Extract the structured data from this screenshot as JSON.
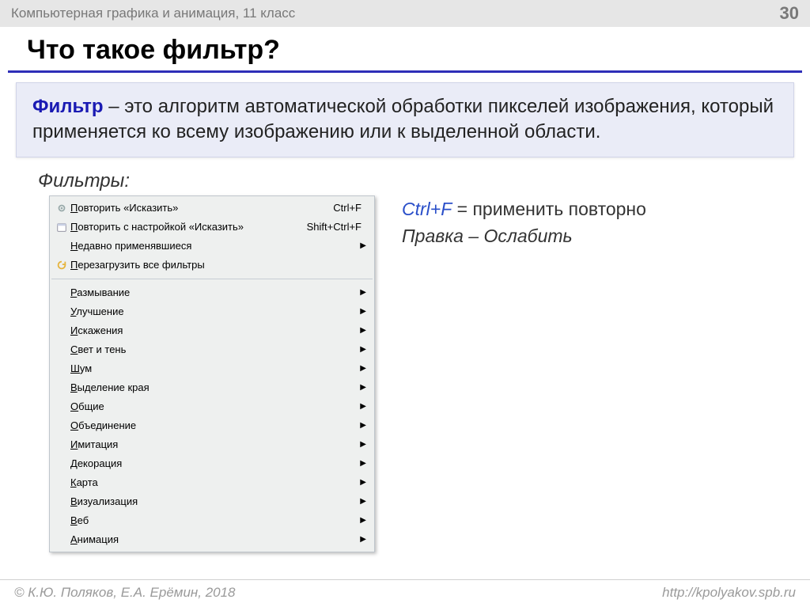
{
  "header": {
    "title": "Компьютерная графика и анимация, 11 класс",
    "page": "30"
  },
  "slide_title": "Что такое фильтр?",
  "definition": {
    "term": "Фильтр",
    "rest": " – это алгоритм автоматической обработки пикселей изображения, который применяется ко всему изображению или к выделенной области."
  },
  "filters_label": "Фильтры:",
  "menu": {
    "top": [
      {
        "first": "П",
        "rest": "овторить «Исказить»",
        "shortcut": "Ctrl+F",
        "icon": "gear"
      },
      {
        "first": "П",
        "rest": "овторить с настройкой «Исказить»",
        "shortcut": "Shift+Ctrl+F",
        "icon": "cal"
      },
      {
        "first": "Н",
        "rest": "едавно применявшиеся",
        "sub": true
      },
      {
        "first": "П",
        "rest": "ерезагрузить все фильтры",
        "icon": "refresh"
      }
    ],
    "categories": [
      {
        "first": "Р",
        "rest": "азмывание"
      },
      {
        "first": "У",
        "rest": "лучшение"
      },
      {
        "first": "И",
        "rest": "скажения"
      },
      {
        "first": "С",
        "rest": "вет и тень"
      },
      {
        "first": "Ш",
        "rest": "ум"
      },
      {
        "first": "В",
        "rest": "ыделение края"
      },
      {
        "first": "О",
        "rest": "бщие"
      },
      {
        "first": "О",
        "rest": "бъединение"
      },
      {
        "first": "И",
        "rest": "митация"
      },
      {
        "first": "Д",
        "rest": "екорация"
      },
      {
        "first": "К",
        "rest": "арта"
      },
      {
        "first": "В",
        "rest": "изуализация"
      },
      {
        "first": "В",
        "rest": "еб"
      },
      {
        "first": "А",
        "rest": "нимация"
      }
    ]
  },
  "side": {
    "kbd": "Ctrl+F",
    "apply": " = применить повторно",
    "edit_fade": "Правка – Ослабить"
  },
  "footer": {
    "left": "© К.Ю. Поляков, Е.А. Ерёмин, 2018",
    "right": "http://kpolyakov.spb.ru"
  }
}
